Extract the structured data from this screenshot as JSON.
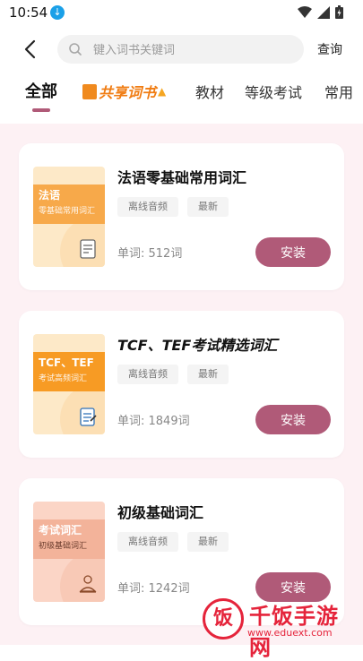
{
  "status": {
    "time": "10:54"
  },
  "search": {
    "placeholder": "键入词书关键词",
    "value": "",
    "query_label": "查询"
  },
  "tabs": [
    {
      "label": "全部"
    },
    {
      "label": "共享词书"
    },
    {
      "label": "教材"
    },
    {
      "label": "等级考试"
    },
    {
      "label": "常用"
    }
  ],
  "books": [
    {
      "title": "法语零基础常用词汇",
      "cover_title": "法语",
      "cover_subtitle": "零基础常用词汇",
      "tags": [
        "离线音频",
        "最新"
      ],
      "count": "单词: 512词",
      "install_label": "安装",
      "cover_colors": {
        "bg": "#fde9c8",
        "band": "#f7a94a"
      }
    },
    {
      "title": "TCF、TEF考试精选词汇",
      "cover_title": "TCF、TEF",
      "cover_subtitle": "考试高频词汇",
      "tags": [
        "离线音频",
        "最新"
      ],
      "count": "单词: 1849词",
      "install_label": "安装",
      "cover_colors": {
        "bg": "#fde9c8",
        "band": "#f79b24"
      }
    },
    {
      "title": "初级基础词汇",
      "cover_title": "考试词汇",
      "cover_subtitle": "初级基础词汇",
      "tags": [
        "离线音频",
        "最新"
      ],
      "count": "单词: 1242词",
      "install_label": "安装",
      "cover_colors": {
        "bg": "#fbd5c6",
        "band": "#f3b39a"
      }
    }
  ],
  "watermark": {
    "badge": "饭",
    "name": "千饭手游网",
    "url": "www.eduext.com"
  },
  "colors": {
    "accent": "#b05a78",
    "content_bg": "#fdf1f4",
    "watermark": "#e5243b"
  }
}
